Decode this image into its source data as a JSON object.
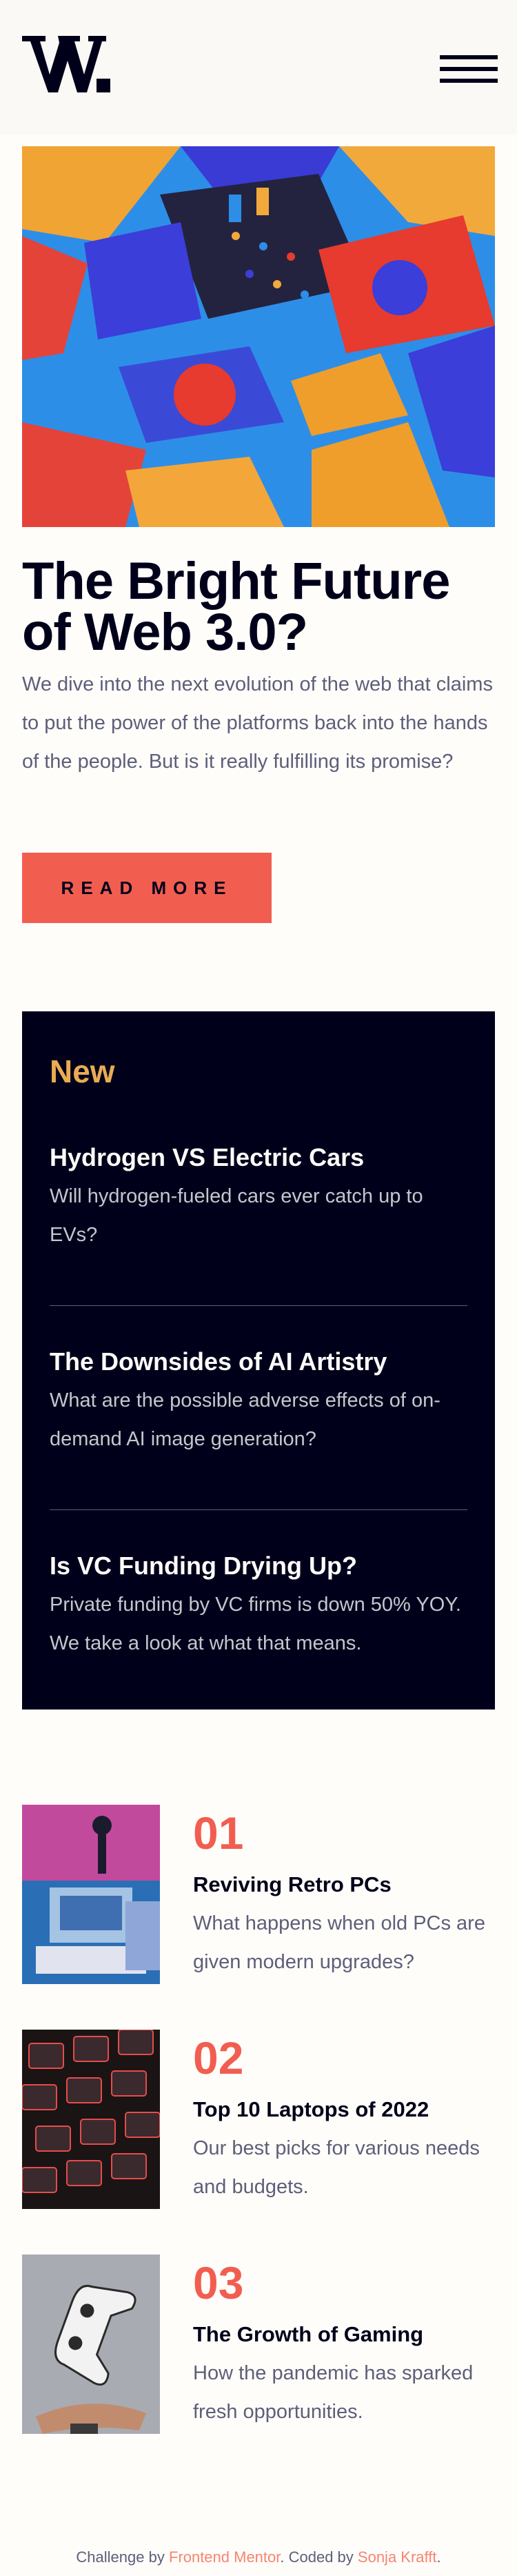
{
  "header": {
    "logo_text": "W.",
    "menu_icon": "hamburger-menu-icon"
  },
  "hero": {
    "image_alt": "Colorful 3D geometric blocks",
    "title": "The Bright Future of Web 3.0?",
    "description": "We dive into the next evolution of the web that claims to put the power of the platforms back into the hands of the people. But is it really fulfilling its promise?",
    "button_label": "READ MORE"
  },
  "new_section": {
    "heading": "New",
    "items": [
      {
        "title": "Hydrogen VS Electric Cars",
        "description": "Will hydrogen-fueled cars ever catch up to EVs?"
      },
      {
        "title": "The Downsides of AI Artistry",
        "description": "What are the possible adverse effects of on-demand AI image generation?"
      },
      {
        "title": "Is VC Funding Drying Up?",
        "description": "Private funding by VC firms is down 50% YOY. We take a look at what that means."
      }
    ]
  },
  "articles": [
    {
      "number": "01",
      "title": "Reviving Retro PCs",
      "description": "What happens when old PCs are given modern upgrades?"
    },
    {
      "number": "02",
      "title": "Top 10 Laptops of 2022",
      "description": "Our best picks for various needs and budgets."
    },
    {
      "number": "03",
      "title": "The Growth of Gaming",
      "description": "How the pandemic has sparked fresh opportunities."
    }
  ],
  "footer": {
    "prefix": "Challenge by ",
    "link1": "Frontend Mentor",
    "middle": ". Coded by ",
    "link2": "Sonja Krafft",
    "suffix": "."
  },
  "colors": {
    "accent_red": "#f15e50",
    "accent_orange": "#e9ab53",
    "dark_blue": "#00001a",
    "grayish_blue": "#5d5f79",
    "off_white": "#fffdfa"
  }
}
